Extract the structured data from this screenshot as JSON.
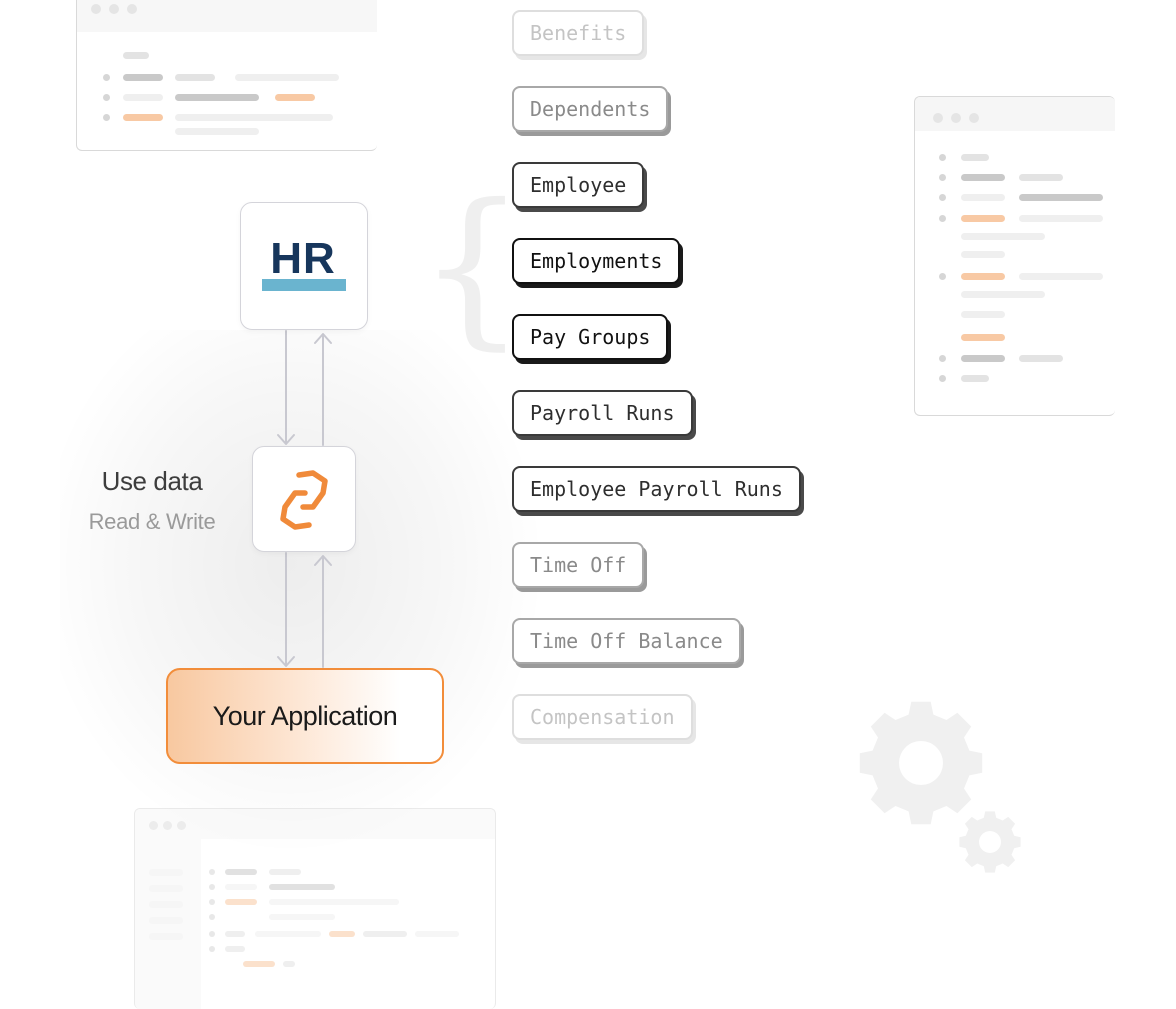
{
  "diagram": {
    "source_logo": {
      "text": "HR",
      "text_color": "#17365c",
      "bar_color": "#6ab4cf"
    },
    "connector_icon": {
      "name": "linked-hexagons-icon",
      "color": "#f08a3a"
    },
    "middle_label": {
      "title": "Use data",
      "subtitle": "Read & Write"
    },
    "target": {
      "label": "Your Application",
      "border_color": "#f28d3a"
    },
    "entities": [
      {
        "label": "Benefits",
        "emphasis": 1
      },
      {
        "label": "Dependents",
        "emphasis": 2
      },
      {
        "label": "Employee",
        "emphasis": 3
      },
      {
        "label": "Employments",
        "emphasis": 4
      },
      {
        "label": "Pay Groups",
        "emphasis": 4
      },
      {
        "label": "Payroll Runs",
        "emphasis": 3
      },
      {
        "label": "Employee Payroll Runs",
        "emphasis": 3
      },
      {
        "label": "Time Off",
        "emphasis": 2
      },
      {
        "label": "Time Off Balance",
        "emphasis": 2
      },
      {
        "label": "Compensation",
        "emphasis": 1
      }
    ]
  },
  "colors": {
    "arrow": "#c8c8d0",
    "gear": "#f0f0f0"
  }
}
